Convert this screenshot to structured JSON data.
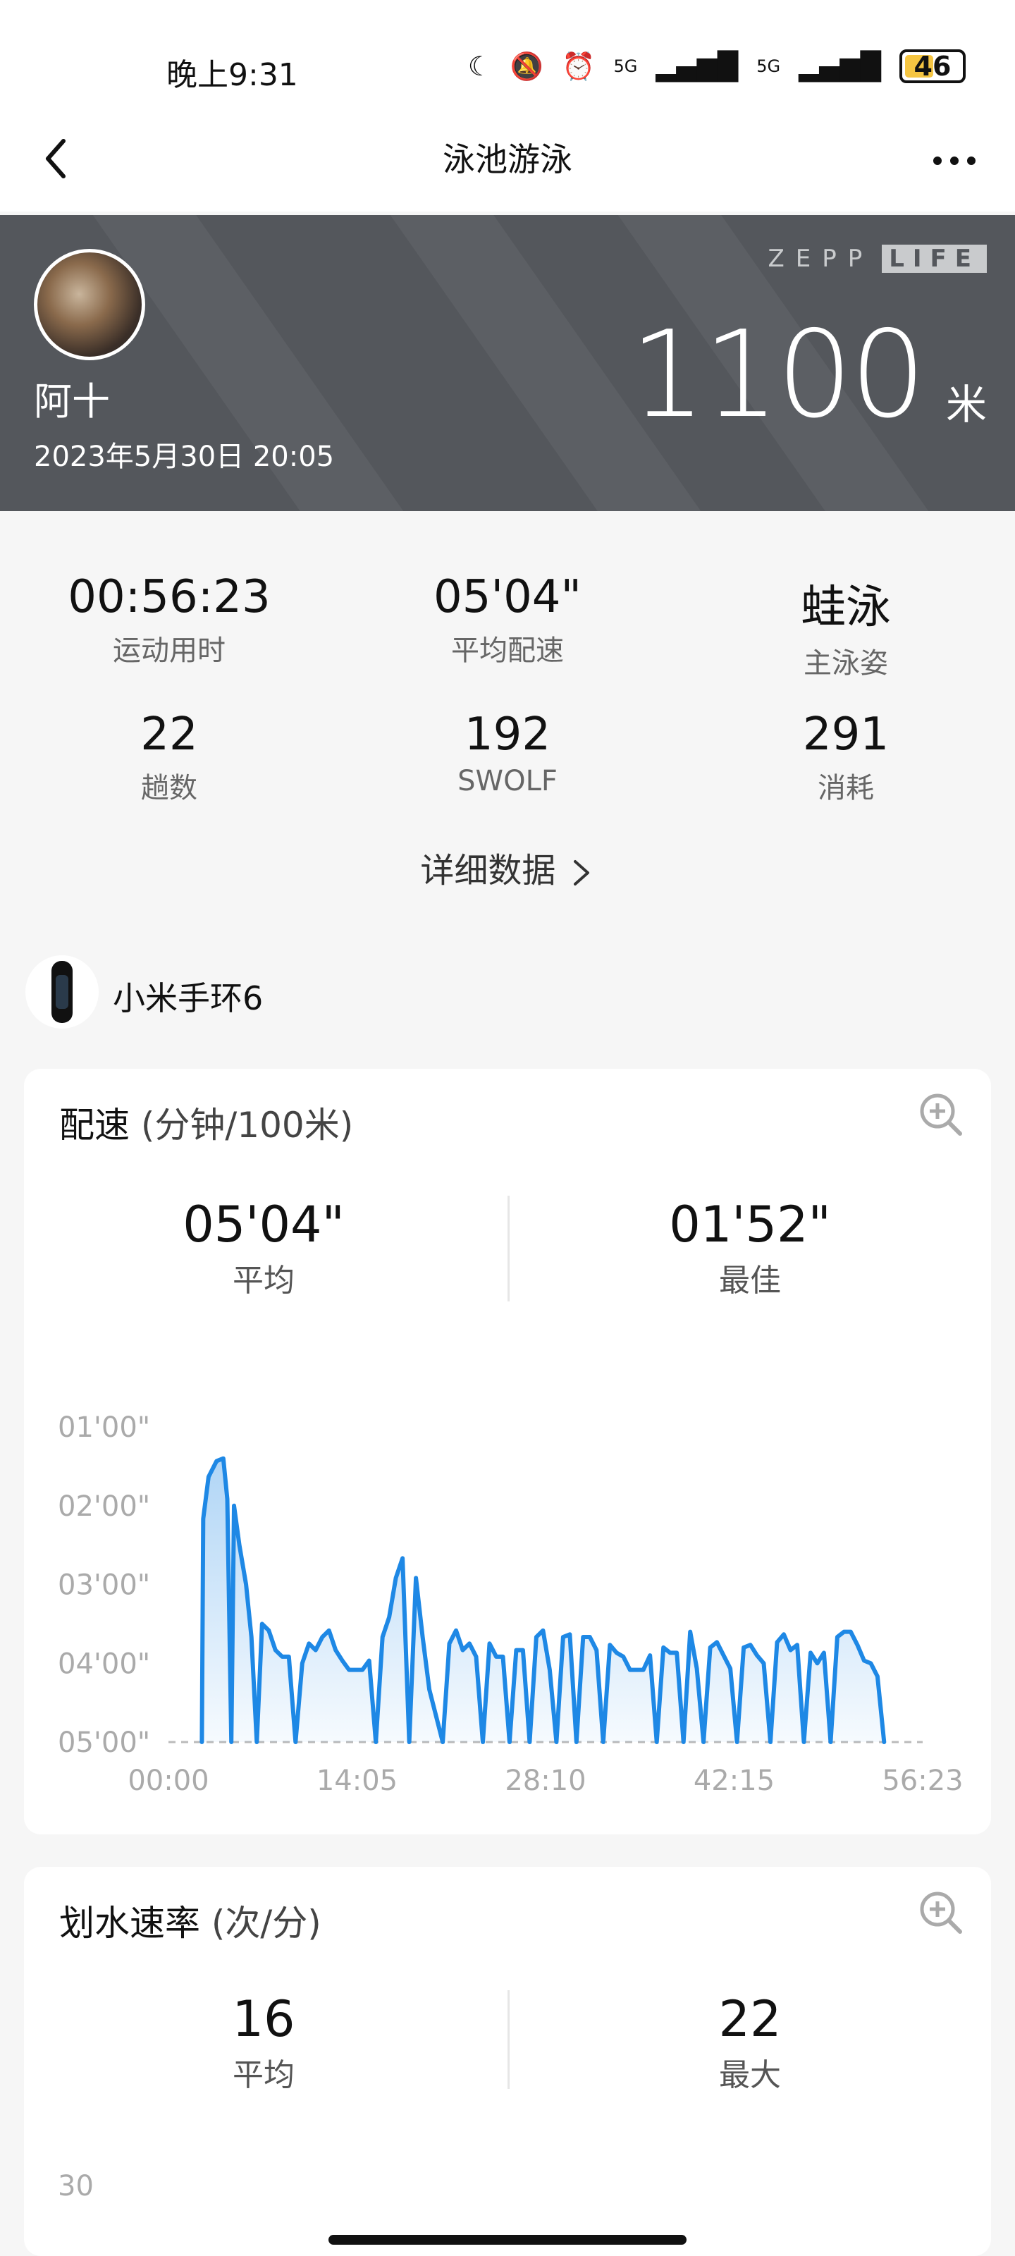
{
  "status_bar": {
    "time": "晚上9:31",
    "network1": "5G",
    "network2": "5G",
    "battery": "46",
    "battery_level": 0.46
  },
  "header": {
    "title": "泳池游泳"
  },
  "hero": {
    "brand_zepp": "ZEPP",
    "brand_life": "LIFE",
    "user_name": "阿十",
    "datetime": "2023年5月30日 20:05",
    "distance": "1100",
    "unit": "米"
  },
  "summary": [
    {
      "value": "00:56:23",
      "label": "运动用时"
    },
    {
      "value": "05'04\"",
      "label": "平均配速"
    },
    {
      "value": "蛙泳",
      "label": "主泳姿"
    },
    {
      "value": "22",
      "label": "趟数"
    },
    {
      "value": "192",
      "label": "SWOLF"
    },
    {
      "value": "291",
      "label": "消耗"
    }
  ],
  "detail_link": "详细数据",
  "device": {
    "name": "小米手环6"
  },
  "pace_card": {
    "title": "配速",
    "unit": "(分钟/100米)",
    "avg_value": "05'04\"",
    "avg_label": "平均",
    "best_value": "01'52\"",
    "best_label": "最佳"
  },
  "stroke_card": {
    "title": "划水速率",
    "unit": "(次/分)",
    "avg_value": "16",
    "avg_label": "平均",
    "max_value": "22",
    "max_label": "最大",
    "y_tick_top": "30"
  },
  "chart_data": {
    "type": "area",
    "y_ticks": [
      "01'00\"",
      "02'00\"",
      "03'00\"",
      "04'00\"",
      "05'00\""
    ],
    "x_ticks": [
      "00:00",
      "14:05",
      "28:10",
      "42:15",
      "56:23"
    ],
    "y_reversed": true,
    "ylim_sec": [
      60,
      300
    ],
    "xlim_min": [
      0,
      56.38
    ],
    "color": "#1e88e5",
    "series": [
      {
        "x": [
          2.5,
          2.6,
          3.0,
          3.6,
          4.1,
          4.4,
          4.7,
          4.9,
          5.3,
          5.8,
          6.2,
          6.6,
          7.0,
          7.5,
          8.0,
          8.5,
          9.0,
          9.5,
          10.0,
          10.5,
          11.0,
          11.5,
          12.0,
          12.5,
          13.0,
          13.5,
          14.0,
          14.5,
          15.0,
          15.5,
          16.0,
          16.5,
          17.0,
          17.5,
          18.0,
          18.5,
          19.0,
          19.5,
          20.0,
          20.5,
          21.0,
          21.5,
          22.0,
          22.5,
          23.0,
          23.5,
          24.0,
          24.5,
          25.0,
          25.5,
          26.0,
          26.5,
          27.0,
          27.5,
          28.0,
          28.5,
          29.0,
          29.5,
          30.0,
          30.5,
          31.0,
          31.5,
          32.0,
          32.5,
          33.0,
          33.5,
          34.0,
          34.5,
          35.0,
          35.5,
          36.0,
          36.5,
          37.0,
          37.5,
          38.0,
          38.5,
          39.0,
          39.5,
          40.0,
          40.5,
          41.0,
          41.5,
          42.0,
          42.5,
          43.0,
          43.5,
          44.0,
          44.5,
          45.0,
          45.5,
          46.0,
          46.5,
          47.0,
          47.5,
          48.0,
          48.5,
          49.0,
          49.5,
          50.0,
          50.5,
          51.0,
          51.5,
          52.0,
          52.5,
          53.0,
          53.5,
          54.0,
          54.4
        ],
        "y_sec": [
          300,
          130,
          98,
          86,
          84,
          115,
          300,
          120,
          150,
          180,
          220,
          300,
          210,
          215,
          230,
          235,
          235,
          300,
          240,
          225,
          230,
          220,
          215,
          230,
          238,
          245,
          245,
          245,
          238,
          300,
          220,
          205,
          175,
          160,
          300,
          175,
          220,
          260,
          280,
          300,
          225,
          215,
          230,
          225,
          235,
          300,
          225,
          235,
          235,
          300,
          230,
          230,
          300,
          220,
          215,
          245,
          300,
          220,
          218,
          300,
          220,
          220,
          230,
          300,
          226,
          232,
          235,
          245,
          245,
          245,
          234,
          300,
          228,
          232,
          232,
          300,
          216,
          244,
          300,
          228,
          224,
          234,
          244,
          300,
          228,
          226,
          234,
          240,
          300,
          224,
          218,
          230,
          226,
          300,
          232,
          240,
          232,
          300,
          220,
          216,
          216,
          226,
          238,
          240,
          250,
          300
        ]
      }
    ]
  }
}
